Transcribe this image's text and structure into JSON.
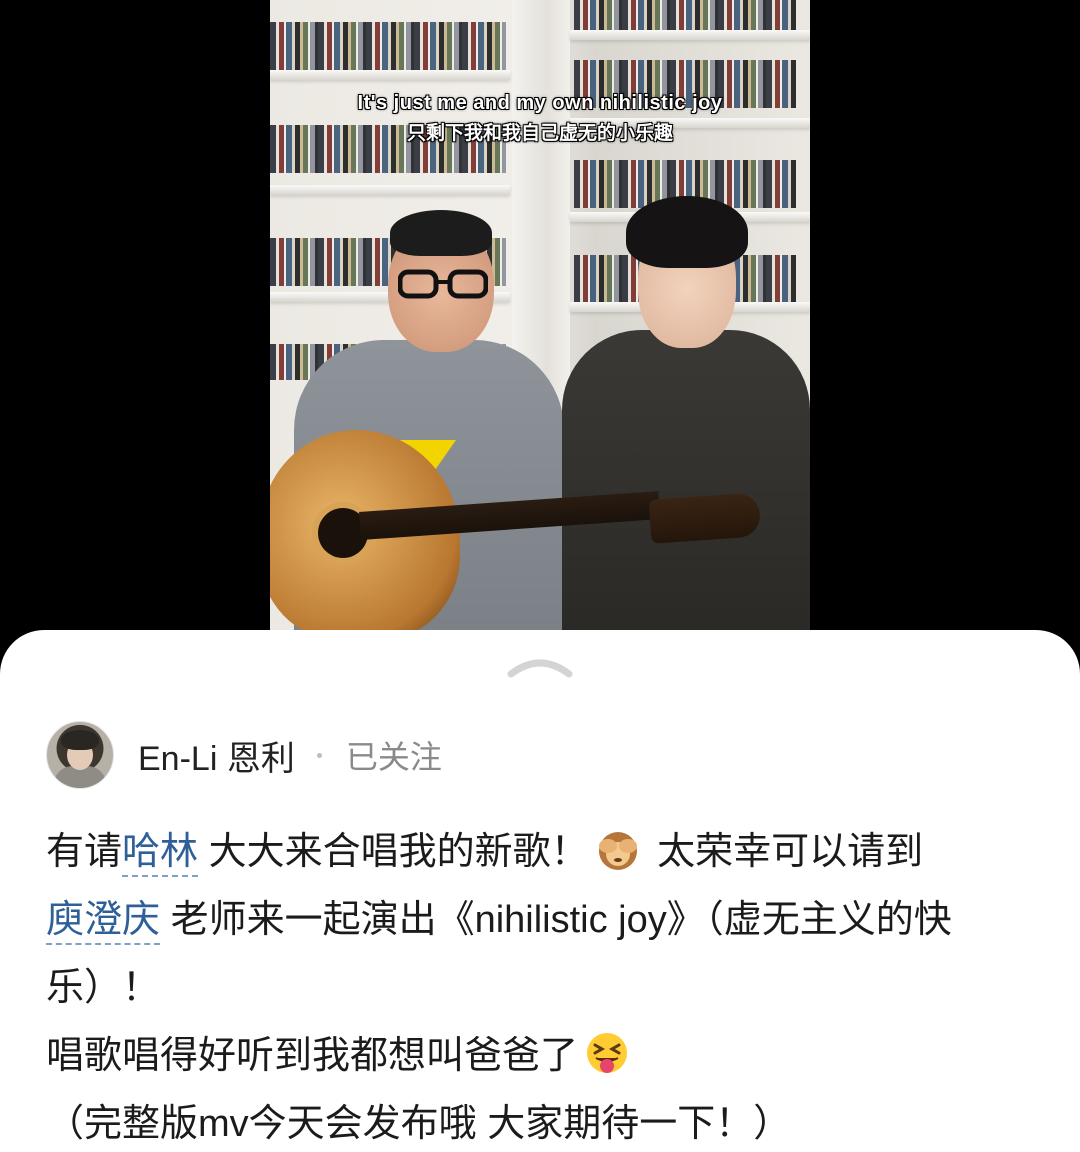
{
  "video": {
    "subtitle_en": "It's just me and my own nihilistic joy",
    "subtitle_zh": "只剩下我和我自己虚无的小乐趣"
  },
  "card": {
    "handle_icon": "chevron-up-icon"
  },
  "author": {
    "name": "En-Li 恩利",
    "follow_status": "已关注"
  },
  "post": {
    "t1": "有请",
    "mention1": "哈林",
    "t2": " 大大来合唱我的新歌！",
    "emoji1": "see-no-evil-monkey-emoji",
    "t3": " 太荣幸可以请到",
    "mention2": "庾澄庆",
    "t4": " 老师来一起演出《nihilistic joy》（虚无主义的快乐）！",
    "t5": "唱歌唱得好听到我都想叫爸爸了",
    "emoji2": "squinting-tongue-emoji",
    "t6": "（完整版mv今天会发布哦 大家期待一下！）"
  }
}
